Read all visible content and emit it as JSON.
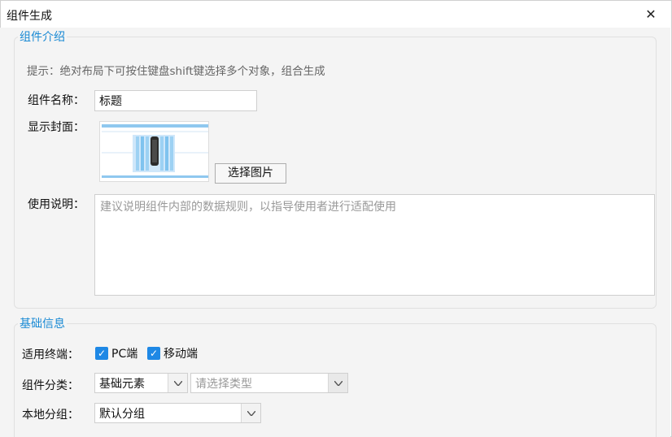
{
  "window": {
    "title": "组件生成",
    "close_glyph": "✕"
  },
  "intro_section": {
    "legend": "组件介绍",
    "hint": "提示：绝对布局下可按住键盘shift键选择多个对象，组合生成",
    "name_label": "组件名称：",
    "name_value": "标题",
    "cover_label": "显示封面：",
    "select_image_button": "选择图片",
    "usage_label": "使用说明：",
    "usage_placeholder": "建议说明组件内部的数据规则，以指导使用者进行适配使用"
  },
  "basic_section": {
    "legend": "基础信息",
    "terminal_label": "适用终端：",
    "terminals": [
      {
        "label": "PC端",
        "checked": true
      },
      {
        "label": "移动端",
        "checked": true
      }
    ],
    "category_label": "组件分类：",
    "category_value": "基础元素",
    "type_placeholder": "请选择类型",
    "local_group_label": "本地分组：",
    "local_group_value": "默认分组"
  },
  "icons": {
    "close": "close-icon",
    "checkbox": "checkmark-icon",
    "dropdown": "chevron-down-icon"
  },
  "colors": {
    "accent": "#1a8ad4",
    "checkbox": "#1e88e5",
    "panel_bg": "#f4f4f4"
  }
}
